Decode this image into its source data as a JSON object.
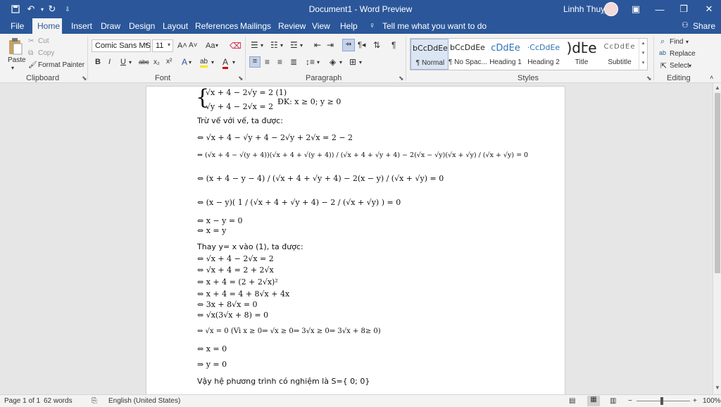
{
  "titlebar": {
    "document_title": "Document1 - Word Preview",
    "user_name": "Linhh Thuỵy"
  },
  "tabs": [
    "File",
    "Home",
    "Insert",
    "Draw",
    "Design",
    "Layout",
    "References",
    "Mailings",
    "Review",
    "View",
    "Help"
  ],
  "tell_me": "Tell me what you want to do",
  "share": "Share",
  "clipboard": {
    "paste": "Paste",
    "cut": "Cut",
    "copy": "Copy",
    "format_painter": "Format Painter",
    "label": "Clipboard"
  },
  "font": {
    "family": "Comic Sans MS",
    "size": "11",
    "label": "Font",
    "bold": "B",
    "italic": "I",
    "underline": "U",
    "strike": "abc",
    "subscript": "x₂",
    "superscript": "x²",
    "grow": "A˄",
    "shrink": "A˅",
    "case": "Aa",
    "effects": "A",
    "highlight": "ab",
    "color": "A"
  },
  "paragraph": {
    "label": "Paragraph"
  },
  "styles": {
    "label": "Styles",
    "items": [
      {
        "preview": "bCcDdEe",
        "name": "¶ Normal"
      },
      {
        "preview": "bCcDdEe",
        "name": "¶ No Spac..."
      },
      {
        "preview": "cDdEe",
        "name": "Heading 1"
      },
      {
        "preview": "·CcDdEe",
        "name": "Heading 2"
      },
      {
        "preview": ")dէe",
        "name": "Title"
      },
      {
        "preview": "CcDdEe",
        "name": "Subtitle"
      }
    ]
  },
  "editing": {
    "label": "Editing",
    "find": "Find",
    "replace": "Replace",
    "select": "Select"
  },
  "document": {
    "lines": [
      "√x + 4 − 2√y = 2 (1)",
      "√y + 4 − 2√x = 2",
      "ĐK: x ≥ 0; y ≥ 0",
      "Trừ vế với vế, ta được:",
      "⇔ √x + 4 − √y + 4 − 2√y + 2√x = 2 − 2",
      "⇔ (√x + 4 − √(y + 4))(√x + 4 + √(y + 4)) / (√x + 4 + √y + 4) − 2(√x − √y)(√x + √y) / (√x + √y) = 0",
      "⇔ (x + 4 − y − 4) / (√x + 4 + √y + 4) − 2(x − y) / (√x + √y) = 0",
      "⇔ (x − y)( 1 / (√x + 4 + √y + 4) − 2 / (√x + √y) ) = 0",
      "⇔ x − y = 0",
      "⇔ x = y",
      "Thay y= x vào (1), ta được:",
      "⇔ √x + 4 − 2√x = 2",
      "⇔ √x + 4 = 2 + 2√x",
      "⇔ x + 4 = (2 + 2√x)²",
      "⇔ x + 4 = 4 + 8√x + 4x",
      "⇔ 3x + 8√x = 0",
      "⇔ √x(3√x + 8) = 0",
      "⇔ √x = 0  (Vì  x  ≥ 0⇒ √x ≥ 0⇒ 3√x ≥ 0⇒ 3√x + 8≥ 0)",
      "⇔ x = 0",
      "⇒ y =  0",
      "Vậy hệ phương trình có nghiệm là S={ 0; 0}"
    ]
  },
  "status": {
    "page": "Page 1 of 1",
    "words": "62 words",
    "language": "English (United States)",
    "zoom": "100%"
  }
}
